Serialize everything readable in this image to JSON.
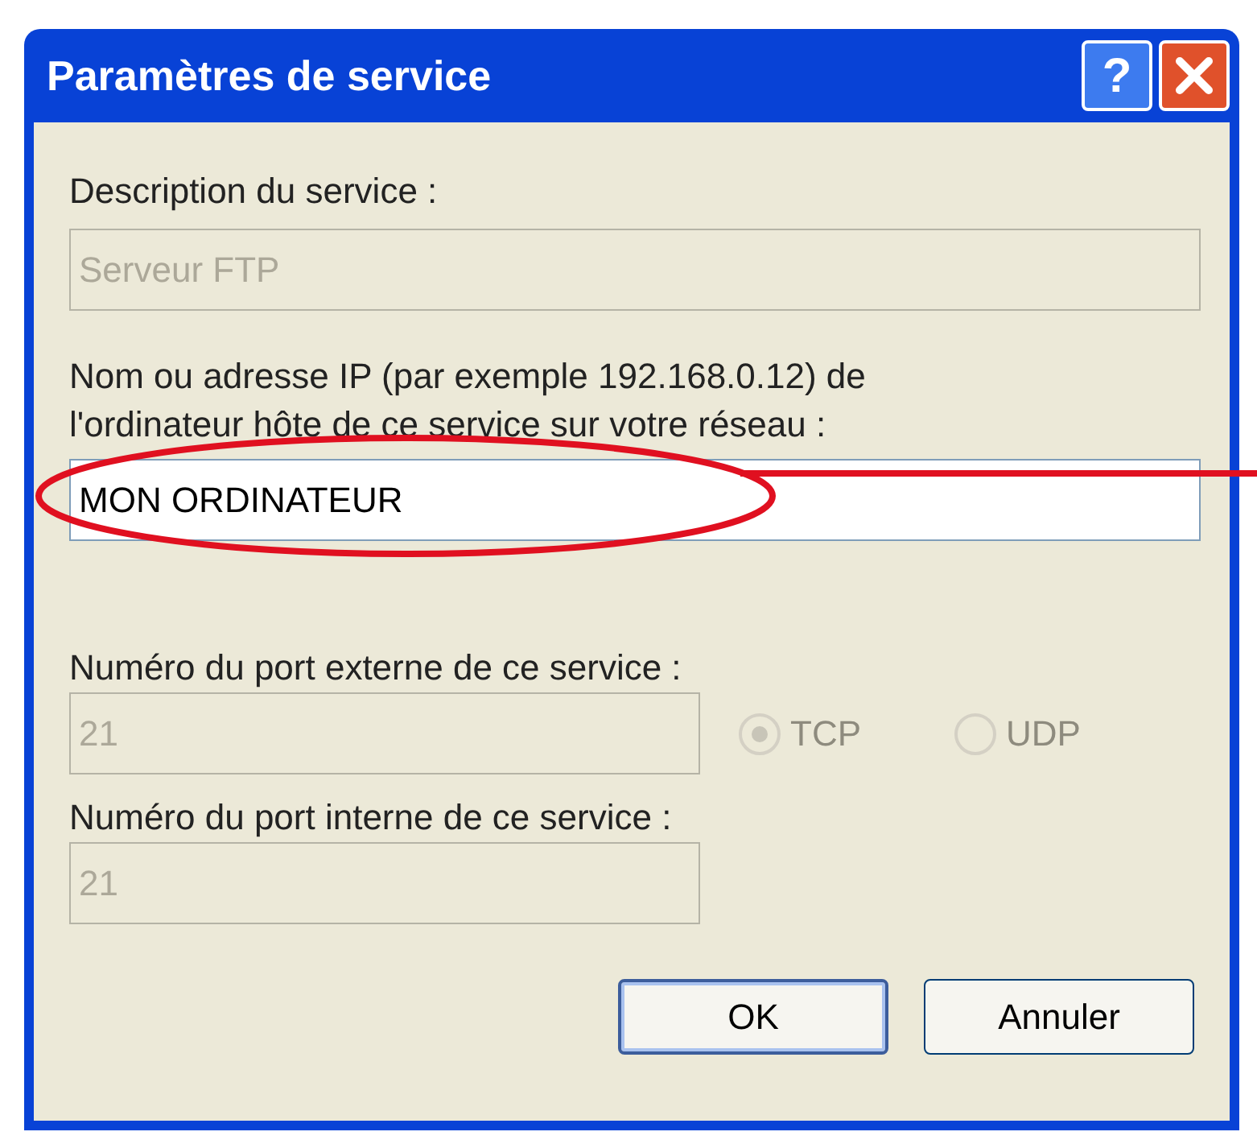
{
  "window": {
    "title": "Paramètres de service"
  },
  "title_buttons": [
    {
      "kind": "help",
      "label": "?"
    },
    {
      "kind": "close"
    }
  ],
  "description": {
    "label": "Description du service :",
    "value": "Serveur FTP",
    "disabled": true
  },
  "host": {
    "label": "Nom ou adresse IP (par exemple 192.168.0.12) de l'ordinateur hôte de ce service sur votre réseau :",
    "value": "MON ORDINATEUR",
    "disabled": false
  },
  "external_port": {
    "label": "Numéro du port externe de ce service :",
    "value": "21",
    "disabled": true
  },
  "protocols": [
    {
      "label": "TCP",
      "selected": true,
      "disabled": true
    },
    {
      "label": "UDP",
      "selected": false,
      "disabled": true
    }
  ],
  "internal_port": {
    "label": "Numéro du port interne de ce service :",
    "value": "21",
    "disabled": true
  },
  "buttons": [
    {
      "label": "OK",
      "default": true
    },
    {
      "label": "Annuler",
      "default": false
    }
  ]
}
